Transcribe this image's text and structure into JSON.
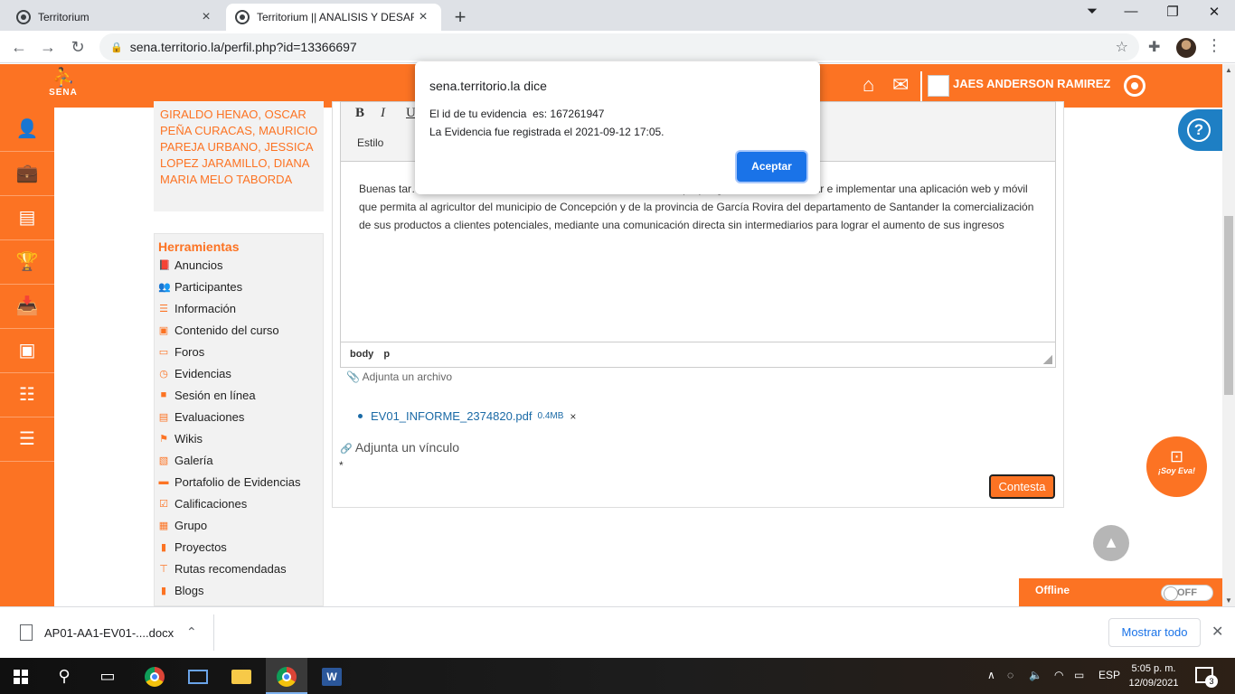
{
  "browser": {
    "tabs": [
      {
        "title": "Territorium"
      },
      {
        "title": "Territorium || ANALISIS Y DESARR"
      }
    ],
    "new_tab": "+",
    "url": "sena.territorio.la/perfil.php?id=13366697"
  },
  "header": {
    "logo_text": "SENA",
    "username": "JAES ANDERSON RAMIREZ"
  },
  "sidebar": {
    "names_text": "GIRALDO HENAO, OSCAR PEÑA CURACAS, MAURICIO PAREJA URBANO, JESSICA LOPEZ JARAMILLO, DIANA MARIA MELO TABORDA",
    "tools_title": "Herramientas",
    "tools": [
      {
        "label": "Anuncios",
        "icon": "📕"
      },
      {
        "label": "Participantes",
        "icon": "👥"
      },
      {
        "label": "Información",
        "icon": "☰"
      },
      {
        "label": "Contenido del curso",
        "icon": "▣"
      },
      {
        "label": "Foros",
        "icon": "▭"
      },
      {
        "label": "Evidencias",
        "icon": "◷"
      },
      {
        "label": "Sesión en línea",
        "icon": "■"
      },
      {
        "label": "Evaluaciones",
        "icon": "▤"
      },
      {
        "label": "Wikis",
        "icon": "⚑"
      },
      {
        "label": "Galería",
        "icon": "▧"
      },
      {
        "label": "Portafolio de Evidencias",
        "icon": "▬"
      },
      {
        "label": "Calificaciones",
        "icon": "☑"
      },
      {
        "label": "Grupo",
        "icon": "▦"
      },
      {
        "label": "Proyectos",
        "icon": "▮"
      },
      {
        "label": "Rutas recomendadas",
        "icon": "⊤"
      },
      {
        "label": "Blogs",
        "icon": "▮"
      }
    ]
  },
  "editor": {
    "bold": "B",
    "italic": "I",
    "underline": "U",
    "style_label": "Estilo",
    "body_text": "Buenas tar… Desarrollo De Un Sistema De Información, en la cual propongo diseñar, desarrollar e implementar una aplicación web y móvil que permita al agricultor del municipio de Concepción y de la provincia de García Rovira del departamento de Santander la comercialización de sus productos a clientes potenciales, mediante una comunicación directa sin intermediarios para lograr el aumento de sus ingresos",
    "path": "body   p"
  },
  "form": {
    "attach_file": "Adjunta un archivo",
    "file_name": "EV01_INFORME_2374820.pdf",
    "file_size": "0.4MB",
    "remove": "×",
    "attach_link": "Adjunta un vínculo",
    "required_mark": "*",
    "submit": "Contesta"
  },
  "widgets": {
    "help": "?",
    "eva_label": "¡Soy Eva!",
    "offline_label": "Offline",
    "toggle_label": "OFF"
  },
  "dialog": {
    "title": "sena.territorio.la dice",
    "line1": "El id de tu evidencia  es: 167261947",
    "line2": "La Evidencia fue registrada el 2021-09-12 17:05.",
    "ok": "Aceptar"
  },
  "downloads": {
    "file": "AP01-AA1-EV01-....docx",
    "show_all": "Mostrar todo"
  },
  "taskbar": {
    "lang": "ESP",
    "time": "5:05 p. m.",
    "date": "12/09/2021",
    "notifications": "3"
  },
  "colors": {
    "brand_orange": "#fc7323",
    "dialog_button": "#1a73e8",
    "help_blue": "#1e7fc4"
  }
}
